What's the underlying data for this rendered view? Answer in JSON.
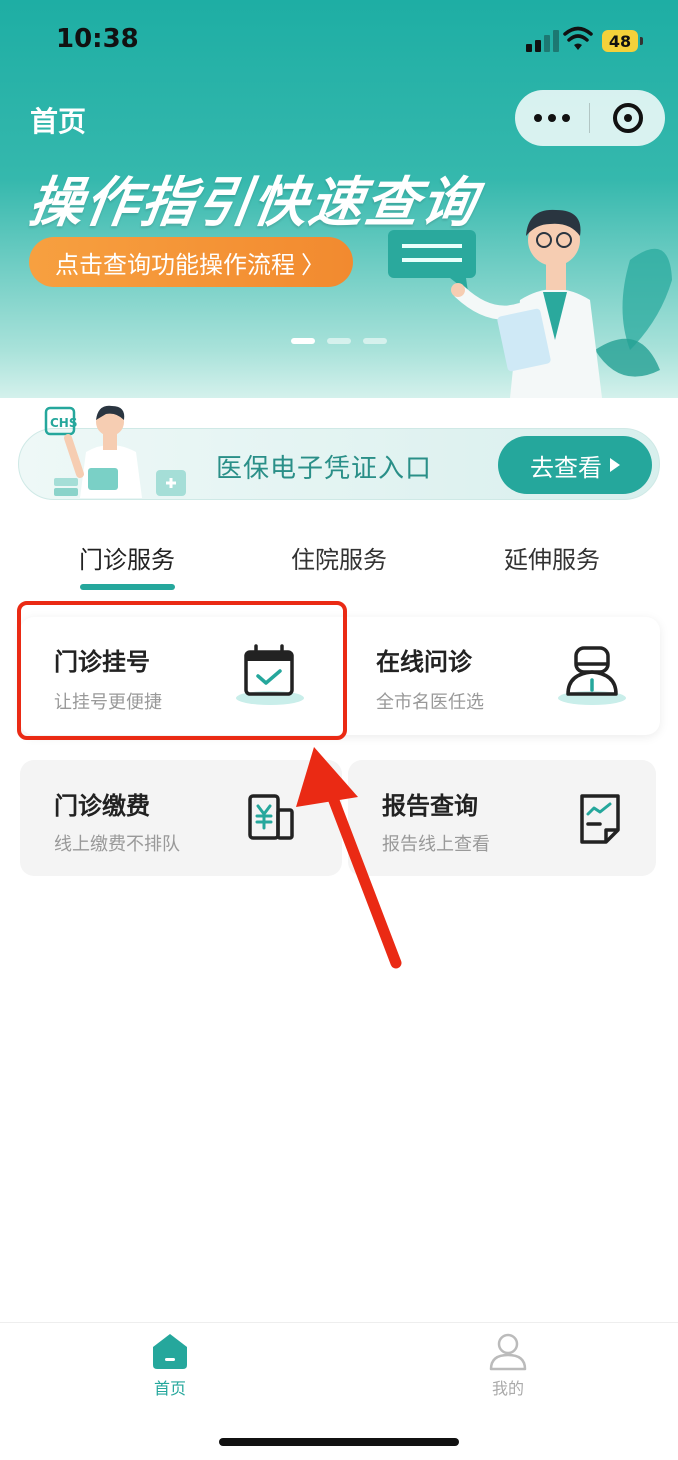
{
  "status_bar": {
    "time": "10:38",
    "battery": "48"
  },
  "header": {
    "title": "首页"
  },
  "banner": {
    "headline": "操作指引快速查询",
    "cta_label": "点击查询功能操作流程",
    "cta_chevron": "〉",
    "page_count": 3,
    "active_page": 1
  },
  "insurance": {
    "label": "医保电子凭证入口",
    "button_label": "去查看",
    "badge": "CHS"
  },
  "tabs": [
    {
      "label": "门诊服务",
      "active": true
    },
    {
      "label": "住院服务",
      "active": false
    },
    {
      "label": "延伸服务",
      "active": false
    }
  ],
  "services": [
    {
      "title": "门诊挂号",
      "subtitle": "让挂号更便捷",
      "icon": "calendar-check-icon"
    },
    {
      "title": "在线问诊",
      "subtitle": "全市名医任选",
      "icon": "doctor-icon"
    },
    {
      "title": "门诊缴费",
      "subtitle": "线上缴费不排队",
      "icon": "payment-yuan-icon"
    },
    {
      "title": "报告查询",
      "subtitle": "报告线上查看",
      "icon": "report-icon"
    }
  ],
  "tabbar": [
    {
      "label": "首页",
      "icon": "home-icon",
      "active": true
    },
    {
      "label": "我的",
      "icon": "user-icon",
      "active": false
    }
  ],
  "colors": {
    "primary": "#25a79c",
    "banner_cta": "#f28a2f",
    "highlight": "#ea2a14"
  }
}
